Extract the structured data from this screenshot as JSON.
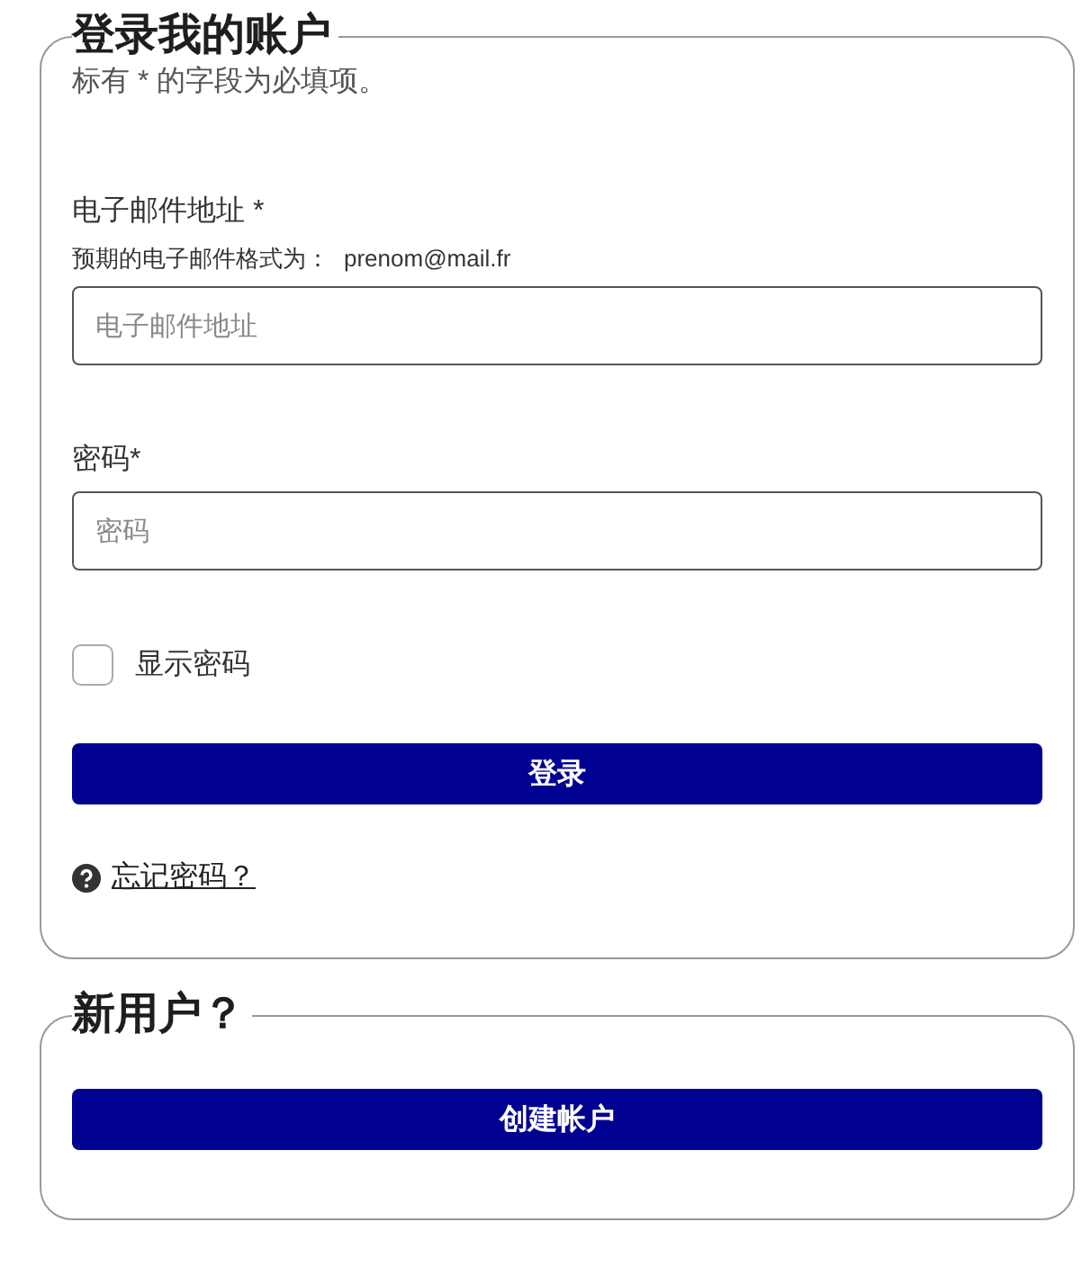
{
  "login": {
    "title": "登录我的账户",
    "required_note": "标有 * 的字段为必填项。",
    "fields": [
      {
        "label": "电子邮件地址 *",
        "hint": "预期的电子邮件格式为：",
        "hint_example": "prenom@mail.fr",
        "placeholder": "电子邮件地址"
      },
      {
        "label": "密码*",
        "placeholder": "密码"
      }
    ],
    "show_password": {
      "label": "显示密码",
      "checked": false
    },
    "submit": "登录",
    "forgot_link": "忘记密码？"
  },
  "register": {
    "title": "新用户？",
    "button": "创建帐户"
  }
}
